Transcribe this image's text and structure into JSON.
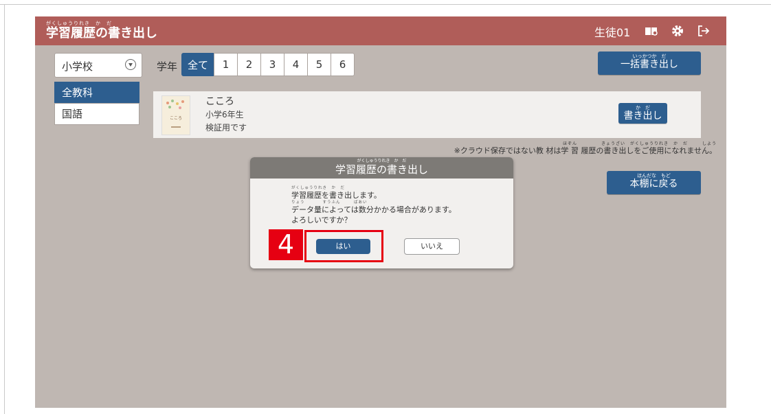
{
  "header": {
    "title_ruby": "がくしゅうりれき　か　だ",
    "title": "学習履歴の書き出し",
    "user": "生徒01",
    "icons": [
      "bookshelf-icon",
      "gear-icon",
      "logout-icon"
    ]
  },
  "filters": {
    "school": "小学校",
    "grade_label": "学年",
    "grades": [
      "全て",
      "1",
      "2",
      "3",
      "4",
      "5",
      "6"
    ],
    "active_grade": "全て"
  },
  "bulk_export": {
    "ruby": "いっかつか　だ",
    "label": "一括書き出し"
  },
  "subjects": [
    {
      "label": "全教科",
      "active": true
    },
    {
      "label": "国語",
      "active": false
    }
  ],
  "book": {
    "title": "こころ",
    "grade": "小学6年生",
    "note": "検証用です",
    "cover_text": "こころ",
    "export_ruby": "か　だ",
    "export_label": "書き出し"
  },
  "cloud_note": {
    "ruby": "ほぞん　　　　　きょうざい　がくしゅうりれき　か　だ　　　しよう",
    "text": "※クラウド保存ではない教 材は学 習 履歴の書き出しをご使用になれません。"
  },
  "back_button": {
    "ruby": "ほんだな　もど",
    "label": "本棚に戻る"
  },
  "dialog": {
    "title_ruby": "がくしゅうりれき　か　だ",
    "title": "学習履歴の書き出し",
    "line1_ruby": "がくしゅうりれき　か　だ",
    "line1": "学習履歴を書き出します。",
    "line2_ruby": "りょう　　　　すうふん　　　ばあい",
    "line2": "データ量によっては数分かかる場合があります。",
    "line3": "よろしいですか？",
    "yes": "はい",
    "no": "いいえ"
  },
  "annotation": {
    "step": "4"
  },
  "colors": {
    "titlebar": "#b05d59",
    "background": "#bfb7b2",
    "accent": "#2d5e8f",
    "highlight": "#e60012"
  }
}
